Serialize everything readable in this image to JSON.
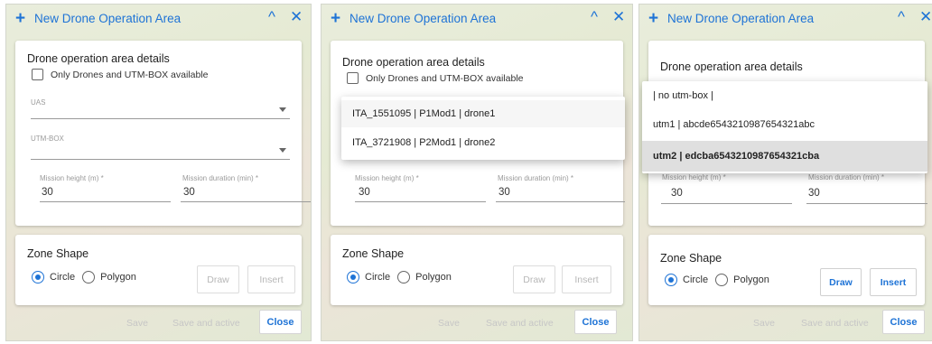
{
  "header": {
    "title": "New Drone Operation Area",
    "add_icon": "+",
    "collapse_icon": "^",
    "close_icon": "✕"
  },
  "details": {
    "title": "Drone operation area details",
    "checkbox_label": "Only Drones and UTM-BOX available",
    "checkbox_checked": false,
    "uas_label": "UAS",
    "utm_label": "UTM-BOX",
    "height_label": "Mission height (m) *",
    "height_value": "30",
    "duration_label": "Mission duration (min) *",
    "duration_value": "30"
  },
  "zone": {
    "title": "Zone Shape",
    "circle_label": "Circle",
    "polygon_label": "Polygon",
    "selected": "Circle",
    "draw_label": "Draw",
    "insert_label": "Insert"
  },
  "footer": {
    "save_label": "Save",
    "save_active_label": "Save and active",
    "close_label": "Close"
  },
  "uas_options": [
    "ITA_1551095 | P1Mod1 | drone1",
    "ITA_3721908 | P2Mod1 | drone2"
  ],
  "utm_options": [
    "| no utm-box |",
    "utm1 | abcde6543210987654321abc",
    "utm2 | edcba6543210987654321cba"
  ],
  "utm_selected": "utm2 | edcba6543210987654321cba",
  "colors": {
    "accent": "#1e73d6",
    "disabled": "#b7b7b7"
  }
}
